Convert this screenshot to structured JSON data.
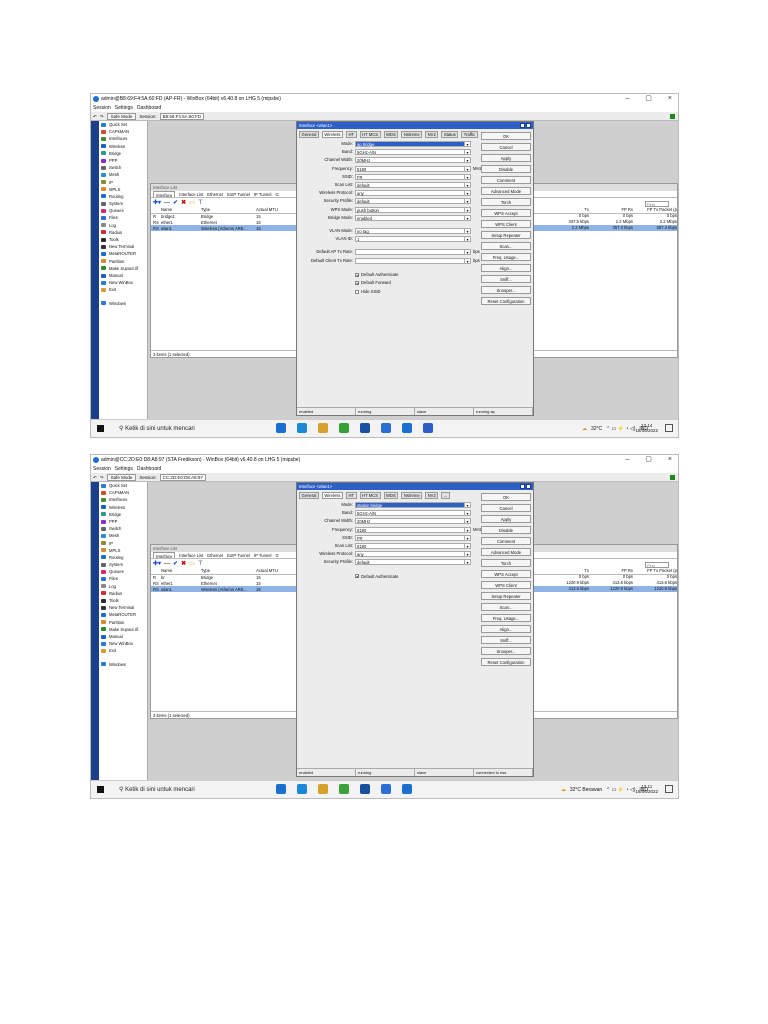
{
  "shots": [
    {
      "window_title": "admin@B8:69:F4:5A:60:FD (AP-FR) - WinBox (64bit) v6.40.8 on LHG 5 (mipsbe)",
      "menu": [
        "Session",
        "Settings",
        "Dashboard"
      ],
      "toolbar": {
        "safe_mode": "Safe Mode",
        "session_label": "Session:",
        "session_value": "B8:69:F4:5A:60:FD"
      },
      "winbox_side_label": "RouterOS WinBox",
      "sidebar": [
        "Quick Set",
        "CAPsMAN",
        "Interfaces",
        "Wireless",
        "Bridge",
        "PPP",
        "Switch",
        "Mesh",
        "IP",
        "MPLS",
        "Routing",
        "System",
        "Queues",
        "Files",
        "Log",
        "Radius",
        "Tools",
        "New Terminal",
        "MetaROUTER",
        "Partition",
        "Make Supout.rif",
        "Manual",
        "New WinBox",
        "Exit"
      ],
      "sidebar_windows": "Windows",
      "iflist": {
        "title": "Interface List",
        "tabs": [
          "Interface",
          "Interface List",
          "Ethernet",
          "EoIP Tunnel",
          "IP Tunnel",
          "G"
        ],
        "find": "Find",
        "columns": [
          "",
          "Name",
          "Type",
          "Actual MTU"
        ],
        "rows": [
          {
            "flag": "R",
            "name": "bridge1",
            "type": "Bridge",
            "mtu": "15"
          },
          {
            "flag": "RS",
            "name": "ether1",
            "type": "Ethernet",
            "mtu": "15"
          },
          {
            "flag": "RS",
            "name": "wlan1",
            "type": "Wireless (Atheros AR9...",
            "mtu": "15"
          }
        ],
        "status": "3 items (1 selected)",
        "right_headers": [
          "Tx",
          "FP Rx",
          "FP Tx Packet (p"
        ],
        "right_rows": [
          [
            "0 bps",
            "0 bps",
            "0 bps"
          ],
          [
            "337.5 kbps",
            "2.2 Mbps",
            "2.2 Mbps"
          ],
          [
            "2.2 Mbps",
            "357.3 kbps",
            "357.3 kbps"
          ]
        ]
      },
      "dialog": {
        "title": "Interface <wlan1>",
        "tabs": [
          "General",
          "Wireless",
          "HT",
          "HT MCS",
          "WDS",
          "Nstreme",
          "NV2",
          "Status",
          "Traffic"
        ],
        "fields": [
          {
            "label": "Mode:",
            "value": "ap bridge",
            "selected": true
          },
          {
            "label": "Band:",
            "value": "5GHz-A/N"
          },
          {
            "label": "Channel Width:",
            "value": "20MHz"
          },
          {
            "label": "Frequency:",
            "value": "5180",
            "unit": "MHz"
          },
          {
            "label": "SSID:",
            "value": "FR"
          },
          {
            "label": "Scan List:",
            "value": "default"
          },
          {
            "label": "Wireless Protocol:",
            "value": "any"
          },
          {
            "label": "Security Profile:",
            "value": "default"
          },
          {
            "label": "WPS Mode:",
            "value": "push button"
          },
          {
            "label": "Bridge Mode:",
            "value": "enabled"
          },
          {
            "label": "VLAN Mode:",
            "value": "no tag"
          },
          {
            "label": "VLAN ID:",
            "value": "1"
          },
          {
            "label": "Default AP Tx Rate:",
            "value": "",
            "unit": "bps"
          },
          {
            "label": "Default Client Tx Rate:",
            "value": "",
            "unit": "bps"
          }
        ],
        "checks": [
          {
            "label": "Default Authenticate",
            "checked": true
          },
          {
            "label": "Default Forward",
            "checked": true
          },
          {
            "label": "Hide SSID",
            "checked": false
          }
        ],
        "buttons": [
          "OK",
          "Cancel",
          "Apply",
          "Disable",
          "Comment",
          "Advanced Mode",
          "Torch",
          "WPS Accept",
          "WPS Client",
          "Setup Repeater",
          "Scan...",
          "Freq. Usage...",
          "Align...",
          "Sniff...",
          "Snooper...",
          "Reset Configuration"
        ],
        "status": [
          "enabled",
          "running",
          "slave",
          "running ap"
        ]
      },
      "taskbar": {
        "search": "Ketik di sini untuk mencari",
        "weather": "32°C",
        "lang": "IND",
        "time": "13.14",
        "date": "18/06/2022"
      }
    },
    {
      "window_title": "admin@CC:2D:E0:D8:A8:97 (STA Fredikson) - WinBox (64bit) v6.40.8 on LHG 5 (mipsbe)",
      "menu": [
        "Session",
        "Settings",
        "Dashboard"
      ],
      "toolbar": {
        "safe_mode": "Safe Mode",
        "session_label": "Session:",
        "session_value": "CC:2D:E0:D8:A8:97"
      },
      "winbox_side_label": "RouterOS WinBox",
      "sidebar": [
        "Quick Set",
        "CAPsMAN",
        "Interfaces",
        "Wireless",
        "Bridge",
        "PPP",
        "Switch",
        "Mesh",
        "IP",
        "MPLS",
        "Routing",
        "System",
        "Queues",
        "Files",
        "Log",
        "Radius",
        "Tools",
        "New Terminal",
        "MetaROUTER",
        "Partition",
        "Make Supout.rif",
        "Manual",
        "New WinBox",
        "Exit"
      ],
      "sidebar_windows": "Windows",
      "iflist": {
        "title": "Interface List",
        "tabs": [
          "Interface",
          "Interface List",
          "Ethernet",
          "EoIP Tunnel",
          "IP Tunnel",
          "G"
        ],
        "find": "Find",
        "columns": [
          "",
          "Name",
          "Type",
          "Actual MTU"
        ],
        "rows": [
          {
            "flag": "R",
            "name": "br",
            "type": "Bridge",
            "mtu": "15"
          },
          {
            "flag": "RS",
            "name": "ether1",
            "type": "Ethernet",
            "mtu": "15"
          },
          {
            "flag": "RS",
            "name": "wlan1",
            "type": "Wireless (Atheros AR9...",
            "mtu": "15"
          }
        ],
        "status": "3 items (1 selected)",
        "right_headers": [
          "Tx",
          "FP Rx",
          "FP Tx Packet (p"
        ],
        "right_rows": [
          [
            "0 bps",
            "0 bps",
            "0 bps"
          ],
          [
            "1220.9 kbps",
            "413.6 kbps",
            "413.6 kbps"
          ],
          [
            "413.6 kbps",
            "1220.9 kbps",
            "1220.9 kbps"
          ]
        ]
      },
      "dialog": {
        "title": "Interface <wlan1>",
        "tabs": [
          "General",
          "Wireless",
          "HT",
          "HT MCS",
          "WDS",
          "Nstreme",
          "NV2",
          "..."
        ],
        "fields": [
          {
            "label": "Mode:",
            "value": "station bridge",
            "selected": true
          },
          {
            "label": "Band:",
            "value": "5GHz-A/N"
          },
          {
            "label": "Channel Width:",
            "value": "20MHz"
          },
          {
            "label": "Frequency:",
            "value": "5180",
            "unit": "MHz"
          },
          {
            "label": "SSID:",
            "value": "FR"
          },
          {
            "label": "Scan List:",
            "value": "5180"
          },
          {
            "label": "Wireless Protocol:",
            "value": "any"
          },
          {
            "label": "Security Profile:",
            "value": "default"
          }
        ],
        "checks": [
          {
            "label": "Default Authenticate",
            "checked": true
          }
        ],
        "buttons": [
          "OK",
          "Cancel",
          "Apply",
          "Disable",
          "Comment",
          "Advanced Mode",
          "Torch",
          "WPS Accept",
          "WPS Client",
          "Setup Repeater",
          "Scan...",
          "Freq. Usage...",
          "Align...",
          "Sniff...",
          "Snooper...",
          "Reset Configuration"
        ],
        "status": [
          "enabled",
          "running",
          "slave",
          "connected to ess"
        ]
      },
      "taskbar": {
        "search": "Ketik di sini untuk mencari",
        "weather": "32°C Berawan",
        "lang": "IND",
        "time": "13.11",
        "date": "18/06/2022"
      }
    }
  ]
}
